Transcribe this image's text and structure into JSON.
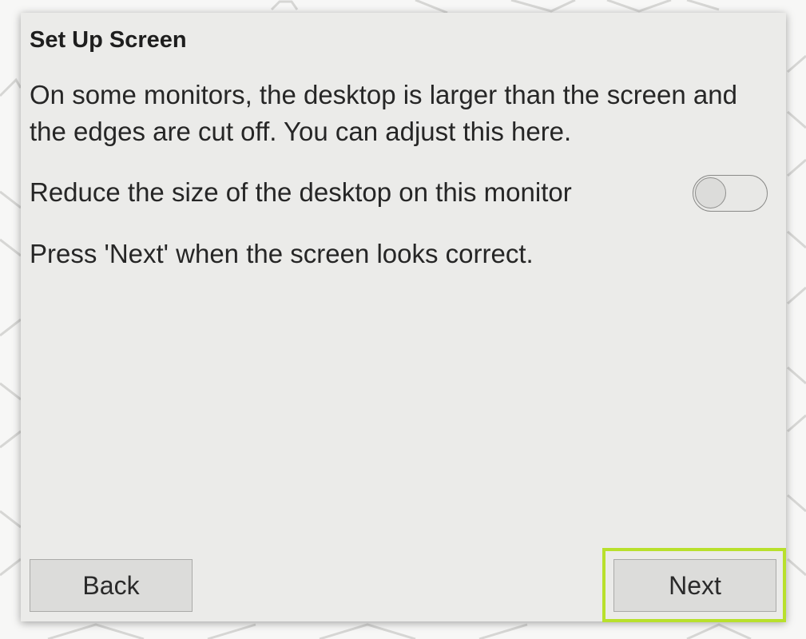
{
  "dialog": {
    "title": "Set Up Screen",
    "description": "On some monitors, the desktop is larger than the screen and the edges are cut off. You can adjust this here.",
    "toggle_label": "Reduce the size of the desktop on this monitor",
    "toggle_state": "off",
    "instruction": "Press 'Next' when the screen looks correct."
  },
  "buttons": {
    "back_label": "Back",
    "next_label": "Next"
  },
  "colors": {
    "dialog_background": "#ebebe9",
    "button_background": "#dcdcda",
    "highlight": "#b8e02c"
  }
}
